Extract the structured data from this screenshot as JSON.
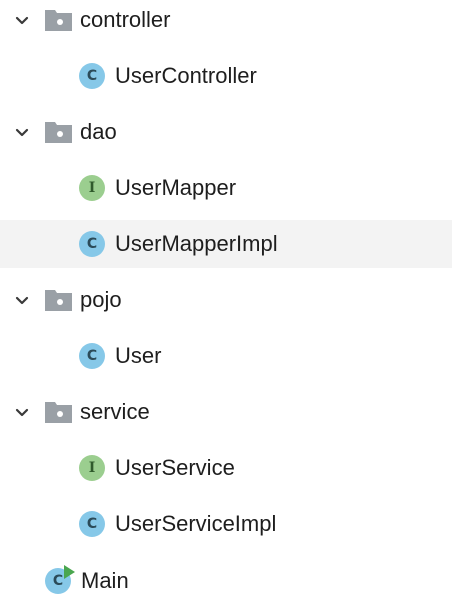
{
  "tree": {
    "items": [
      {
        "label": "controller",
        "type": "folder",
        "expanded": true,
        "icon": "folder-icon"
      },
      {
        "label": "UserController",
        "type": "class",
        "icon": "class-icon"
      },
      {
        "label": "dao",
        "type": "folder",
        "expanded": true,
        "icon": "folder-icon"
      },
      {
        "label": "UserMapper",
        "type": "interface",
        "icon": "interface-icon"
      },
      {
        "label": "UserMapperImpl",
        "type": "class",
        "icon": "class-icon",
        "selected": true
      },
      {
        "label": "pojo",
        "type": "folder",
        "expanded": true,
        "icon": "folder-icon"
      },
      {
        "label": "User",
        "type": "class",
        "icon": "class-icon"
      },
      {
        "label": "service",
        "type": "folder",
        "expanded": true,
        "icon": "folder-icon"
      },
      {
        "label": "UserService",
        "type": "interface",
        "icon": "interface-icon"
      },
      {
        "label": "UserServiceImpl",
        "type": "class",
        "icon": "class-icon"
      },
      {
        "label": "Main",
        "type": "main-class",
        "icon": "main-class-icon"
      }
    ],
    "icon_letters": {
      "class": "C",
      "interface": "I"
    },
    "colors": {
      "folder": "#9aa0a6",
      "class": "#86c8e8",
      "interface": "#9bce8f",
      "run_arrow": "#4aa64f",
      "selection": "#f3f3f3"
    }
  }
}
